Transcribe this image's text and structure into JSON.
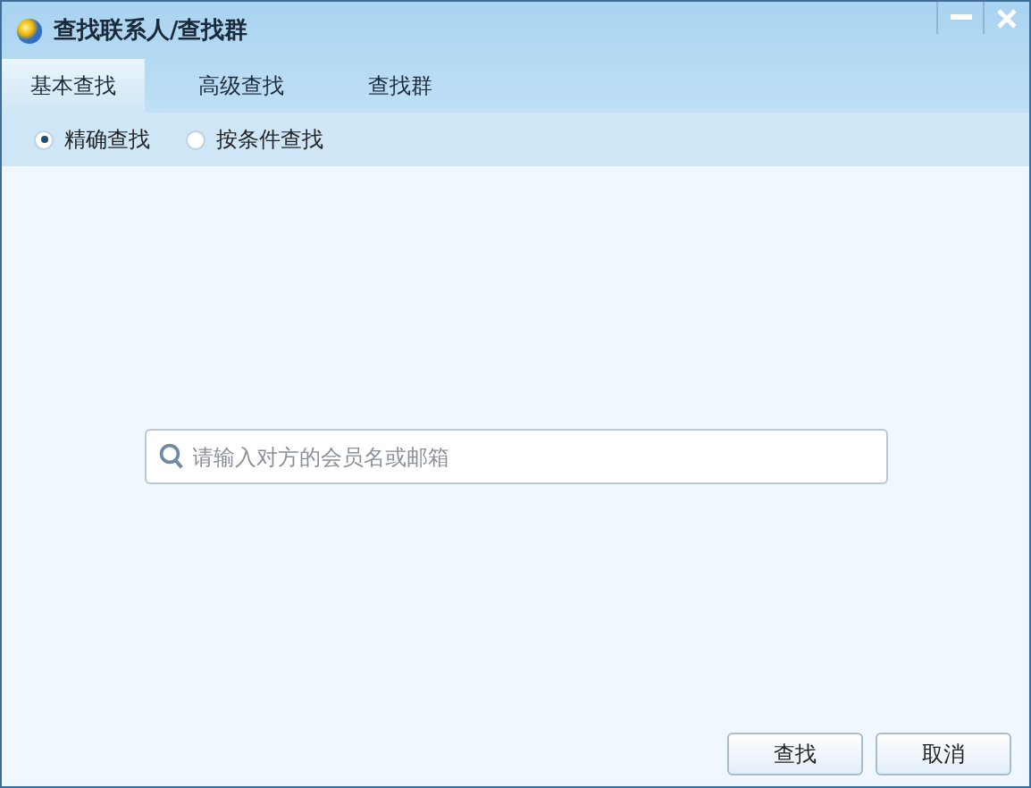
{
  "window": {
    "title": "查找联系人/查找群"
  },
  "tabs": [
    {
      "label": "基本查找",
      "selected": true
    },
    {
      "label": "高级查找",
      "selected": false
    },
    {
      "label": "查找群",
      "selected": false
    }
  ],
  "search_modes": [
    {
      "label": "精确查找",
      "selected": true
    },
    {
      "label": "按条件查找",
      "selected": false
    }
  ],
  "search": {
    "placeholder": "请输入对方的会员名或邮箱"
  },
  "buttons": [
    "查找",
    "取消"
  ]
}
